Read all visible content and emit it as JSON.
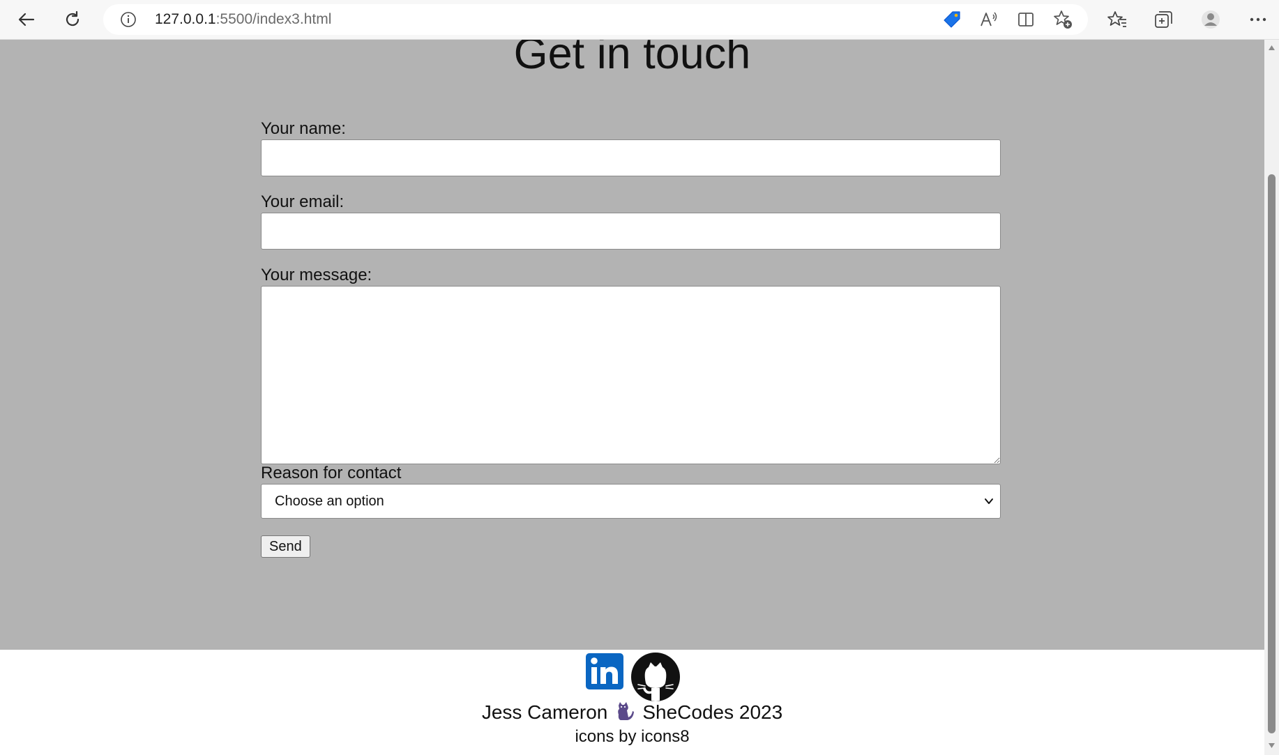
{
  "browser": {
    "url_host": "127.0.0.1",
    "url_rest": ":5500/index3.html",
    "icons": [
      "back-arrow-icon",
      "refresh-icon",
      "site-info-icon",
      "shopping-tag-icon",
      "read-aloud-icon",
      "split-screen-icon",
      "add-favorite-icon",
      "favorites-icon",
      "collections-icon",
      "profile-icon",
      "more-icon"
    ]
  },
  "page": {
    "title": "Get in touch",
    "form": {
      "name_label": "Your name:",
      "name_value": "",
      "email_label": "Your email:",
      "email_value": "",
      "message_label": "Your message:",
      "message_value": "",
      "reason_label": "Reason for contact",
      "reason_selected": "Choose an option",
      "send_label": "Send"
    },
    "footer": {
      "author": "Jess Cameron",
      "org": "SheCodes 2023",
      "icons_credit": "icons by icons8",
      "social": [
        "linkedin-icon",
        "github-icon"
      ]
    }
  },
  "colors": {
    "form_background": "#b3b3b3",
    "footer_background": "#ffffff",
    "linkedin_blue": "#0a66c2",
    "tag_blue": "#1a73e8"
  }
}
